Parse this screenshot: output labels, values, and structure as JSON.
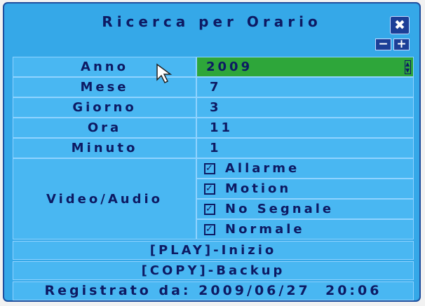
{
  "dialog": {
    "title": "Ricerca per Orario",
    "close_label": "✖",
    "minus_label": "−",
    "plus_label": "+"
  },
  "fields": [
    {
      "label": "Anno",
      "value": "2009"
    },
    {
      "label": "Mese",
      "value": "7"
    },
    {
      "label": "Giorno",
      "value": "3"
    },
    {
      "label": "Ora",
      "value": "11"
    },
    {
      "label": "Minuto",
      "value": "1"
    }
  ],
  "video_audio": {
    "label": "Video/Audio",
    "options": [
      {
        "label": "Allarme",
        "checked": true
      },
      {
        "label": "Motion",
        "checked": true
      },
      {
        "label": "No Segnale",
        "checked": true
      },
      {
        "label": "Normale",
        "checked": true
      }
    ],
    "check_mark": "✓"
  },
  "actions": {
    "play": "[PLAY]-Inizio",
    "copy": "[COPY]-Backup"
  },
  "footer": {
    "label": "Registrato da:",
    "datetime": "2009/06/27  20:06"
  },
  "colors": {
    "panel": "#35a8e8",
    "cell": "#49b7f2",
    "text": "#0d1a63",
    "selected": "#2ea63a",
    "button": "#1c3f97"
  },
  "icons": {
    "spin": "spin-arrows-icon",
    "cursor": "mouse-pointer-icon"
  }
}
